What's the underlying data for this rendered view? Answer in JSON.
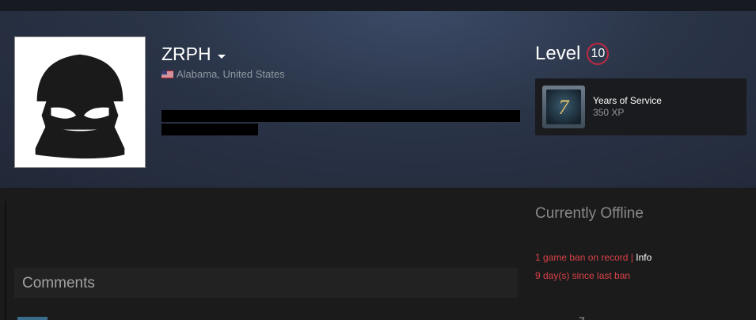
{
  "profile": {
    "persona_name": "ZRPH",
    "location": "Alabama, United States",
    "level_label": "Level",
    "level_value": "10"
  },
  "badge": {
    "title": "Years of Service",
    "xp": "350 XP",
    "number": "7"
  },
  "status": {
    "text": "Currently Offline",
    "ban_record": "1 game ban on record",
    "separator": "|",
    "info": "Info",
    "since_last_ban": "9 day(s) since last ban"
  },
  "comments": {
    "title": "Comments"
  },
  "icons": {
    "avatar": "masked-person-avatar",
    "flag": "us-flag-icon",
    "dropdown": "caret-down-icon"
  },
  "colors": {
    "header_bg": "#2a3447",
    "ban_red": "#d94147",
    "level_ring": "#c02942"
  }
}
